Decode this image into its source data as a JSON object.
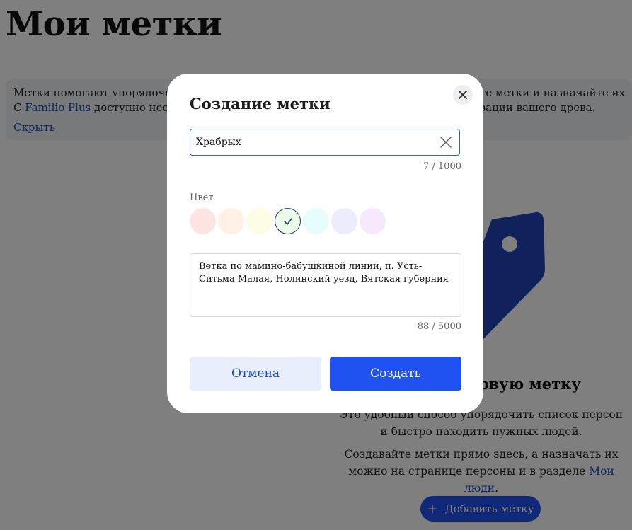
{
  "page": {
    "title": "Мои метки",
    "info": {
      "line1": "Метки помогают упорядочить",
      "line2_prefix": "С ",
      "line2_link": "Familio Plus",
      "line2_suffix": " доступно неогр",
      "right_line1": "йте метки и назначайте их",
      "right_line2": "изации вашего древа.",
      "hide_link": "Скрыть"
    },
    "empty": {
      "title": "рвую метку",
      "desc1": "Это удобный способ упорядочить список персон и быстро находить нужных людей.",
      "desc2_prefix": "Создавайте метки прямо здесь, а назначать их можно на странице персоны и в разделе ",
      "desc2_link": "Мои люди",
      "desc2_suffix": ".",
      "add_button": "Добавить метку"
    }
  },
  "modal": {
    "title": "Создание метки",
    "name_value": "Храбрых",
    "name_counter": "7 / 1000",
    "color_label": "Цвет",
    "swatches": [
      {
        "color": "#ffe4e4",
        "selected": false
      },
      {
        "color": "#fff0e6",
        "selected": false
      },
      {
        "color": "#fdfde6",
        "selected": false
      },
      {
        "color": "#eefae8",
        "selected": true
      },
      {
        "color": "#e6fcfd",
        "selected": false
      },
      {
        "color": "#ececfd",
        "selected": false
      },
      {
        "color": "#f7e8fd",
        "selected": false
      }
    ],
    "description_value": "Ветка по мамино-бабушкиной линии, п. Усть-Ситьма Малая, Нолинский уезд, Вятская губерния",
    "description_counter": "88 / 5000",
    "cancel_label": "Отмена",
    "create_label": "Создать"
  },
  "colors": {
    "accent": "#1f52f0",
    "link": "#1b49c4",
    "tag_illustration": "#2143b8"
  }
}
